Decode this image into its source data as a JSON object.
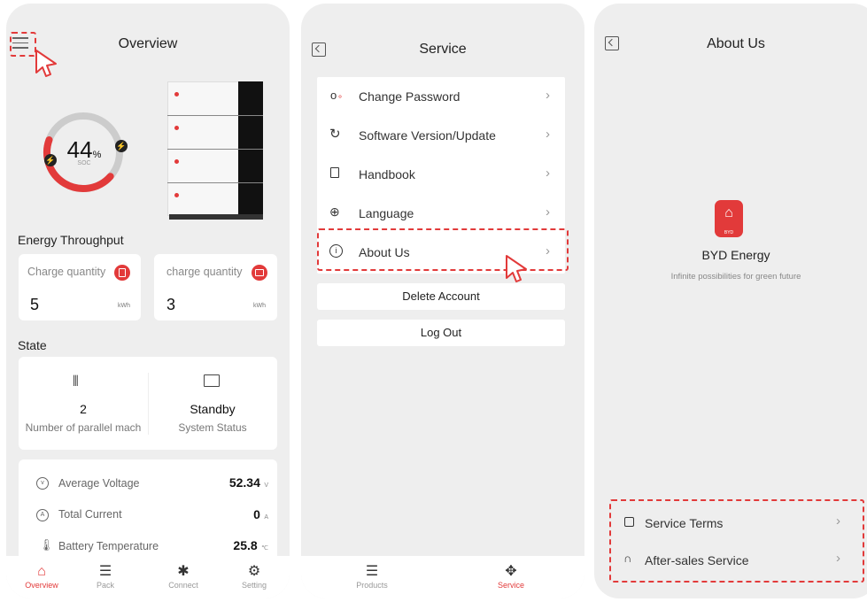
{
  "overview": {
    "title": "Overview",
    "soc_value": "44",
    "soc_unit": "%",
    "soc_label": "SOC",
    "soc_fraction": 0.44,
    "energy_section": "Energy Throughput",
    "charge_label": "Charge quantity",
    "charge_value": "5",
    "charge_unit": "kWh",
    "discharge_label": "charge quantity",
    "discharge_value": "3",
    "discharge_unit": "kWh",
    "state_section": "State",
    "parallel_value": "2",
    "parallel_label": "Number of parallel mach",
    "system_value": "Standby",
    "system_label": "System Status",
    "metrics": [
      {
        "label": "Average Voltage",
        "value": "52.34",
        "unit": "V"
      },
      {
        "label": "Total Current",
        "value": "0",
        "unit": "A"
      },
      {
        "label": "Battery Temperature",
        "value": "25.8",
        "unit": "℃"
      }
    ],
    "tabs": [
      {
        "label": "Overview"
      },
      {
        "label": "Pack"
      },
      {
        "label": "Connect"
      },
      {
        "label": "Setting"
      }
    ]
  },
  "service": {
    "title": "Service",
    "items": [
      {
        "label": "Change Password"
      },
      {
        "label": "Software Version/Update"
      },
      {
        "label": "Handbook"
      },
      {
        "label": "Language"
      },
      {
        "label": "About Us"
      }
    ],
    "delete_label": "Delete Account",
    "logout_label": "Log Out",
    "tabs": [
      {
        "label": "Products"
      },
      {
        "label": "Service"
      }
    ]
  },
  "about": {
    "title": "About Us",
    "logo_text": "BYD",
    "app_name": "BYD Energy",
    "tagline": "Infinite possibilities for green future",
    "items": [
      {
        "label": "Service Terms"
      },
      {
        "label": "After-sales Service"
      }
    ]
  },
  "colors": {
    "accent": "#e23a3a",
    "track": "#cccccc"
  }
}
